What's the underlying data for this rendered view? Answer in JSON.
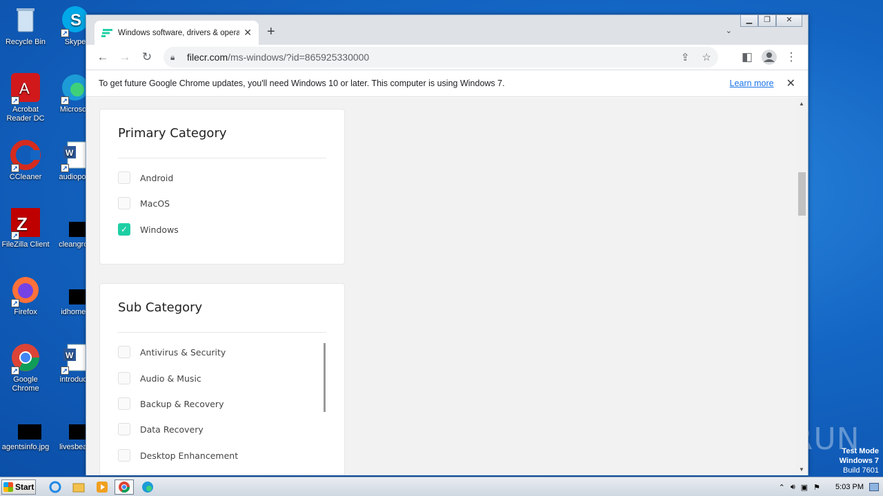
{
  "desktop": {
    "icons": [
      {
        "label": "Recycle Bin"
      },
      {
        "label": "Skype"
      },
      {
        "label": "Acrobat Reader DC"
      },
      {
        "label": "Microsoft"
      },
      {
        "label": "CCleaner"
      },
      {
        "label": "audiopolit"
      },
      {
        "label": "FileZilla Client"
      },
      {
        "label": "cleangrov"
      },
      {
        "label": "Firefox"
      },
      {
        "label": "idhomes"
      },
      {
        "label": "Google Chrome"
      },
      {
        "label": "introducti"
      },
      {
        "label": "agentsinfo.jpg"
      },
      {
        "label": "livesbeac"
      }
    ],
    "watermark": "ANY RUN",
    "test_mode": {
      "line1": "Test Mode",
      "line2": "Windows 7",
      "line3": "Build 7601"
    }
  },
  "browser": {
    "tab_title": "Windows software, drivers & operat",
    "url_host": "filecr.com",
    "url_path": "/ms-windows/?id=865925330000",
    "infobar_message": "To get future Google Chrome updates, you'll need Windows 10 or later. This computer is using Windows 7.",
    "infobar_link": "Learn more"
  },
  "page": {
    "primary_category": {
      "title": "Primary Category",
      "options": [
        {
          "label": "Android",
          "checked": false
        },
        {
          "label": "MacOS",
          "checked": false
        },
        {
          "label": "Windows",
          "checked": true
        }
      ]
    },
    "sub_category": {
      "title": "Sub Category",
      "options": [
        {
          "label": "Antivirus & Security",
          "checked": false
        },
        {
          "label": "Audio & Music",
          "checked": false
        },
        {
          "label": "Backup & Recovery",
          "checked": false
        },
        {
          "label": "Data Recovery",
          "checked": false
        },
        {
          "label": "Desktop Enhancement",
          "checked": false
        }
      ]
    }
  },
  "taskbar": {
    "start_label": "Start",
    "clock": "5:03 PM"
  },
  "colors": {
    "accent_check": "#1fcfa4",
    "link": "#1a73e8"
  }
}
